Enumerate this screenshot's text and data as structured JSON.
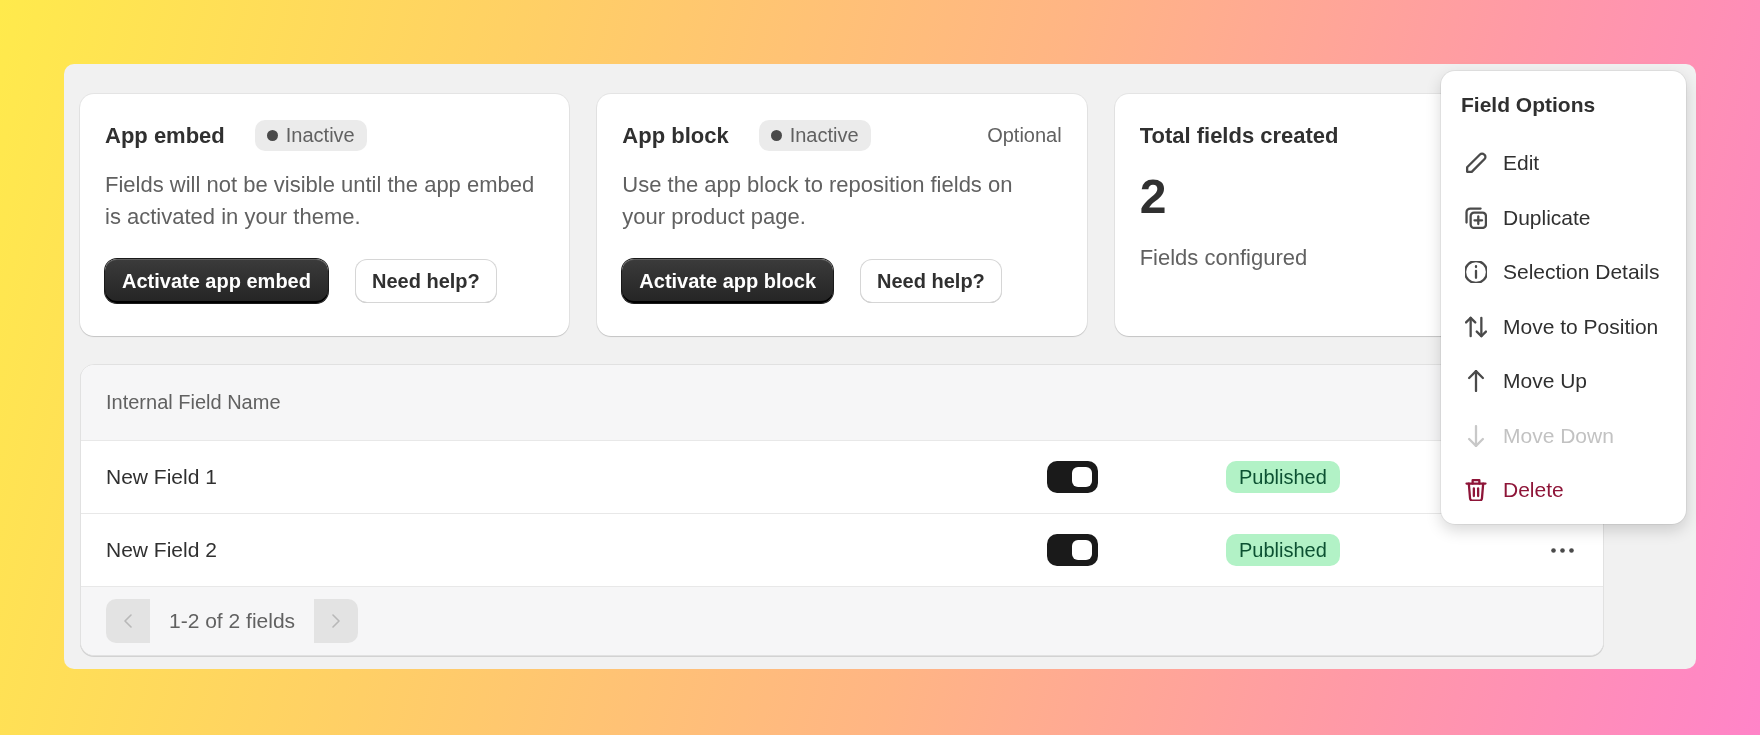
{
  "cards": [
    {
      "kind": "setup",
      "title": "App embed",
      "status": "Inactive",
      "description": "Fields will not be visible until the app embed is activated in your theme.",
      "buttons": [
        "Activate app embed",
        "Need help?"
      ]
    },
    {
      "kind": "setup",
      "title": "App block",
      "status": "Inactive",
      "note": "Optional",
      "description": "Use the app block to reposition fields on your product page.",
      "buttons": [
        "Activate app block",
        "Need help?"
      ]
    },
    {
      "kind": "stat",
      "title": "Total fields created",
      "value": "2",
      "caption": "Fields configured"
    }
  ],
  "table": {
    "columns": [
      "Internal Field Name"
    ],
    "rows": [
      {
        "name": "New Field 1",
        "on": true,
        "status": "Published",
        "menu_open": true
      },
      {
        "name": "New Field 2",
        "on": true,
        "status": "Published",
        "menu_open": false
      }
    ],
    "pagination": {
      "range": "1-2 of 2 fields",
      "previous": {
        "disabled": true
      },
      "next": {
        "disabled": true
      }
    }
  },
  "menu": {
    "title": "Field Options",
    "items": [
      {
        "kind": "edit",
        "label": "Edit",
        "disabled": false,
        "destructive": false
      },
      {
        "kind": "duplicate",
        "label": "Duplicate",
        "disabled": false,
        "destructive": false
      },
      {
        "kind": "details",
        "label": "Selection Details",
        "disabled": false,
        "destructive": false
      },
      {
        "kind": "reposition",
        "label": "Move to Position",
        "disabled": false,
        "destructive": false
      },
      {
        "kind": "up",
        "label": "Move Up",
        "disabled": false,
        "destructive": false
      },
      {
        "kind": "down",
        "label": "Move Down",
        "disabled": true,
        "destructive": false
      },
      {
        "kind": "delete",
        "label": "Delete",
        "disabled": false,
        "destructive": true
      }
    ]
  }
}
